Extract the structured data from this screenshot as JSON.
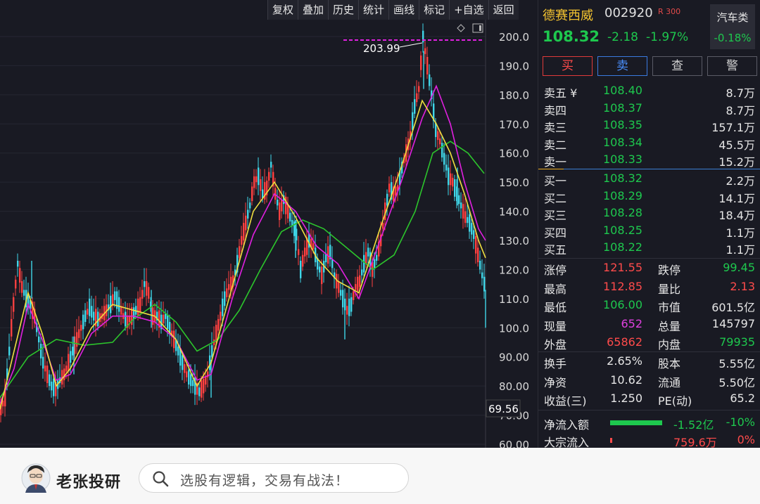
{
  "toolbar": [
    "复权",
    "叠加",
    "历史",
    "统计",
    "画线",
    "标记",
    "+自选",
    "返回"
  ],
  "chart_data": {
    "type": "candlestick",
    "y_ticks": [
      "200.0",
      "190.0",
      "180.0",
      "170.0",
      "160.0",
      "150.0",
      "140.0",
      "130.0",
      "120.0",
      "110.0",
      "100.0",
      "90.00",
      "80.00",
      "70.00",
      "60.00"
    ],
    "ylim": [
      60,
      200
    ],
    "high_label": "203.99",
    "low_label": "69.56",
    "close_path": [
      [
        0,
        72
      ],
      [
        6,
        76
      ],
      [
        12,
        92
      ],
      [
        18,
        108
      ],
      [
        24,
        122
      ],
      [
        30,
        114
      ],
      [
        36,
        110
      ],
      [
        42,
        108
      ],
      [
        48,
        104
      ],
      [
        54,
        96
      ],
      [
        60,
        88
      ],
      [
        66,
        84
      ],
      [
        72,
        80
      ],
      [
        78,
        79
      ],
      [
        84,
        82
      ],
      [
        90,
        84
      ],
      [
        96,
        88
      ],
      [
        102,
        92
      ],
      [
        108,
        96
      ],
      [
        114,
        100
      ],
      [
        120,
        104
      ],
      [
        126,
        107
      ],
      [
        132,
        104
      ],
      [
        138,
        103
      ],
      [
        144,
        104
      ],
      [
        150,
        106
      ],
      [
        156,
        108
      ],
      [
        162,
        111
      ],
      [
        168,
        108
      ],
      [
        174,
        104
      ],
      [
        180,
        102
      ],
      [
        186,
        104
      ],
      [
        192,
        106
      ],
      [
        198,
        108
      ],
      [
        204,
        115
      ],
      [
        210,
        112
      ],
      [
        216,
        104
      ],
      [
        222,
        104
      ],
      [
        228,
        102
      ],
      [
        234,
        104
      ],
      [
        240,
        100
      ],
      [
        246,
        96
      ],
      [
        252,
        92
      ],
      [
        258,
        88
      ],
      [
        264,
        84
      ],
      [
        270,
        82
      ],
      [
        276,
        80
      ],
      [
        282,
        78
      ],
      [
        288,
        80
      ],
      [
        294,
        84
      ],
      [
        300,
        92
      ],
      [
        306,
        98
      ],
      [
        312,
        104
      ],
      [
        318,
        110
      ],
      [
        324,
        114
      ],
      [
        330,
        116
      ],
      [
        336,
        122
      ],
      [
        342,
        130
      ],
      [
        348,
        136
      ],
      [
        354,
        142
      ],
      [
        360,
        150
      ],
      [
        366,
        152
      ],
      [
        372,
        146
      ],
      [
        378,
        148
      ],
      [
        384,
        156
      ],
      [
        390,
        146
      ],
      [
        396,
        140
      ],
      [
        402,
        144
      ],
      [
        408,
        140
      ],
      [
        414,
        136
      ],
      [
        420,
        132
      ],
      [
        426,
        120
      ],
      [
        432,
        126
      ],
      [
        438,
        130
      ],
      [
        444,
        128
      ],
      [
        450,
        122
      ],
      [
        456,
        118
      ],
      [
        462,
        124
      ],
      [
        468,
        126
      ],
      [
        474,
        118
      ],
      [
        480,
        114
      ],
      [
        486,
        110
      ],
      [
        492,
        106
      ],
      [
        498,
        108
      ],
      [
        504,
        114
      ],
      [
        510,
        116
      ],
      [
        516,
        122
      ],
      [
        522,
        126
      ],
      [
        528,
        120
      ],
      [
        534,
        124
      ],
      [
        540,
        130
      ],
      [
        546,
        140
      ],
      [
        552,
        148
      ],
      [
        558,
        146
      ],
      [
        564,
        148
      ],
      [
        570,
        155
      ],
      [
        576,
        160
      ],
      [
        582,
        166
      ],
      [
        588,
        176
      ],
      [
        594,
        182
      ],
      [
        600,
        200
      ],
      [
        606,
        190
      ],
      [
        612,
        180
      ],
      [
        618,
        168
      ],
      [
        624,
        164
      ],
      [
        630,
        158
      ],
      [
        636,
        152
      ],
      [
        642,
        150
      ],
      [
        648,
        146
      ],
      [
        654,
        142
      ],
      [
        660,
        138
      ],
      [
        666,
        136
      ],
      [
        672,
        132
      ],
      [
        678,
        125
      ],
      [
        684,
        118
      ],
      [
        690,
        112
      ]
    ],
    "ma_magenta": [
      [
        0,
        74
      ],
      [
        20,
        86
      ],
      [
        40,
        108
      ],
      [
        60,
        96
      ],
      [
        80,
        82
      ],
      [
        100,
        84
      ],
      [
        130,
        98
      ],
      [
        160,
        104
      ],
      [
        190,
        104
      ],
      [
        220,
        102
      ],
      [
        250,
        96
      ],
      [
        280,
        82
      ],
      [
        300,
        84
      ],
      [
        330,
        110
      ],
      [
        360,
        132
      ],
      [
        390,
        146
      ],
      [
        420,
        140
      ],
      [
        450,
        128
      ],
      [
        480,
        122
      ],
      [
        510,
        110
      ],
      [
        540,
        130
      ],
      [
        570,
        150
      ],
      [
        600,
        172
      ],
      [
        620,
        183
      ],
      [
        640,
        170
      ],
      [
        660,
        150
      ],
      [
        680,
        134
      ],
      [
        690,
        130
      ]
    ],
    "ma_yellow": [
      [
        0,
        72
      ],
      [
        20,
        92
      ],
      [
        40,
        112
      ],
      [
        60,
        98
      ],
      [
        80,
        80
      ],
      [
        100,
        86
      ],
      [
        130,
        100
      ],
      [
        160,
        108
      ],
      [
        190,
        106
      ],
      [
        220,
        104
      ],
      [
        250,
        96
      ],
      [
        280,
        80
      ],
      [
        300,
        88
      ],
      [
        330,
        114
      ],
      [
        360,
        140
      ],
      [
        390,
        150
      ],
      [
        420,
        138
      ],
      [
        450,
        124
      ],
      [
        480,
        116
      ],
      [
        510,
        112
      ],
      [
        540,
        134
      ],
      [
        570,
        155
      ],
      [
        600,
        178
      ],
      [
        620,
        170
      ],
      [
        640,
        160
      ],
      [
        660,
        146
      ],
      [
        680,
        130
      ],
      [
        690,
        124
      ]
    ],
    "ma_green": [
      [
        0,
        76
      ],
      [
        40,
        90
      ],
      [
        80,
        96
      ],
      [
        120,
        94
      ],
      [
        160,
        95
      ],
      [
        190,
        103
      ],
      [
        220,
        108
      ],
      [
        250,
        102
      ],
      [
        280,
        92
      ],
      [
        310,
        96
      ],
      [
        340,
        106
      ],
      [
        370,
        120
      ],
      [
        400,
        133
      ],
      [
        430,
        137
      ],
      [
        460,
        134
      ],
      [
        490,
        128
      ],
      [
        510,
        124
      ],
      [
        530,
        120
      ],
      [
        560,
        125
      ],
      [
        590,
        140
      ],
      [
        615,
        160
      ],
      [
        640,
        164
      ],
      [
        665,
        160
      ],
      [
        688,
        153
      ]
    ],
    "cyan_spikes": [
      [
        45,
        118
      ],
      [
        105,
        92
      ],
      [
        215,
        108
      ],
      [
        300,
        84
      ],
      [
        420,
        132
      ],
      [
        490,
        104
      ],
      [
        602,
        190
      ],
      [
        650,
        150
      ],
      [
        690,
        108
      ]
    ]
  },
  "stock": {
    "name": "德赛西威",
    "code": "002920",
    "badge": "R 300",
    "price": "108.32",
    "change": "-2.18",
    "change_pct": "-1.97%",
    "sector": "汽车类",
    "sector_pct": "-0.18%"
  },
  "actions": [
    "买",
    "卖",
    "查",
    "警"
  ],
  "asks": [
    {
      "label": "卖五 ¥",
      "price": "108.40",
      "vol": "8.7万"
    },
    {
      "label": "卖四",
      "price": "108.37",
      "vol": "8.7万"
    },
    {
      "label": "卖三",
      "price": "108.35",
      "vol": "157.1万"
    },
    {
      "label": "卖二",
      "price": "108.34",
      "vol": "45.5万"
    },
    {
      "label": "卖一",
      "price": "108.33",
      "vol": "15.2万"
    }
  ],
  "bids": [
    {
      "label": "买一",
      "price": "108.32",
      "vol": "2.2万"
    },
    {
      "label": "买二",
      "price": "108.29",
      "vol": "14.1万"
    },
    {
      "label": "买三",
      "price": "108.28",
      "vol": "18.4万"
    },
    {
      "label": "买四",
      "price": "108.25",
      "vol": "1.1万"
    },
    {
      "label": "买五",
      "price": "108.22",
      "vol": "1.1万"
    }
  ],
  "stats1": [
    {
      "l1": "涨停",
      "v1": "121.55",
      "c1": "red",
      "l2": "跌停",
      "v2": "99.45",
      "c2": "grn"
    },
    {
      "l1": "最高",
      "v1": "112.85",
      "c1": "red",
      "l2": "量比",
      "v2": "2.13",
      "c2": "red"
    },
    {
      "l1": "最低",
      "v1": "106.00",
      "c1": "grn",
      "l2": "市值",
      "v2": "601.5亿",
      "c2": "wht"
    },
    {
      "l1": "现量",
      "v1": "652",
      "c1": "mag",
      "l2": "总量",
      "v2": "145797",
      "c2": "wht"
    },
    {
      "l1": "外盘",
      "v1": "65862",
      "c1": "red",
      "l2": "内盘",
      "v2": "79935",
      "c2": "grn"
    }
  ],
  "stats2": [
    {
      "l1": "换手",
      "v1": "2.65%",
      "c1": "wht",
      "l2": "股本",
      "v2": "5.55亿",
      "c2": "wht"
    },
    {
      "l1": "净资",
      "v1": "10.62",
      "c1": "wht",
      "l2": "流通",
      "v2": "5.50亿",
      "c2": "wht"
    },
    {
      "l1": "收益(三)",
      "v1": "1.250",
      "c1": "wht",
      "l2": "PE(动)",
      "v2": "65.2",
      "c2": "wht"
    }
  ],
  "flow": [
    {
      "label": "净流入额",
      "value": "-1.52亿",
      "pct": "-10%",
      "color": "grn",
      "bar": 1.0
    },
    {
      "label": "大宗流入",
      "value": "759.6万",
      "pct": "0%",
      "color": "red",
      "bar": 0.04
    }
  ],
  "banner": {
    "brand": "老张投研",
    "search_placeholder": "选股有逻辑，交易有战法！"
  }
}
